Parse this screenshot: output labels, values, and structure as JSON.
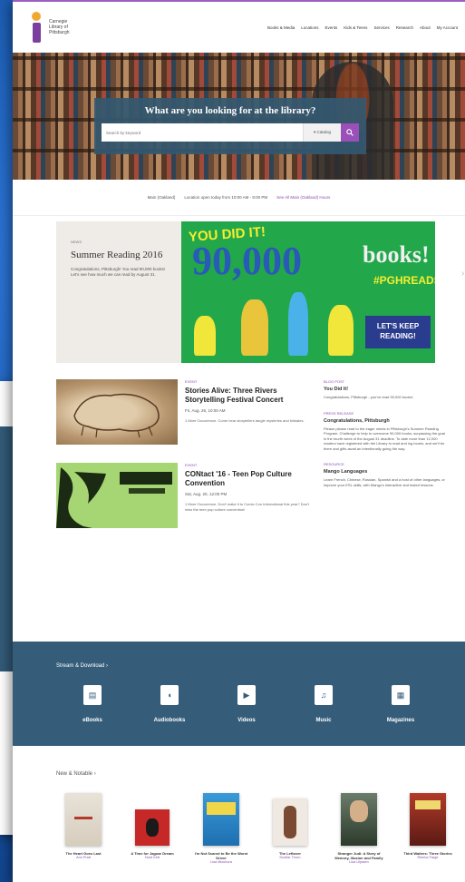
{
  "logo": {
    "line1": "Carnegie",
    "line2": "Library of",
    "line3": "Pittsburgh"
  },
  "nav": [
    "Books & Media",
    "Locations",
    "Events",
    "Kids & Teens",
    "Services",
    "Research",
    "About",
    "My Account"
  ],
  "search": {
    "title": "What are you looking for at the library?",
    "placeholder": "Search by keyword",
    "filter": "▾ Catalog",
    "submit_icon": "search-icon"
  },
  "hours": {
    "location": "Main (Oakland)",
    "hours_text": "Location open today from 10:00 AM - 8:00 PM",
    "link": "See All Main (Oakland) Hours"
  },
  "feature": {
    "kicker": "NEWS",
    "title": "Summer Reading 2016",
    "body": "Congratulations, Pittsburgh! You read 90,000 books! Let's see how much we can read by August 31.",
    "banner": {
      "you_did_it": "YOU DID IT!",
      "number": "90,000",
      "books": "books!",
      "hashtag": "#PGHREADS",
      "keep_reading_1": "LET'S KEEP",
      "keep_reading_2": "READING!"
    }
  },
  "events": [
    {
      "kicker": "EVENT",
      "title": "Stories Alive: Three Rivers Storytelling Festival Concert",
      "date": "Fri, Aug. 26, 10:00 AM",
      "desc": "1 More Occurrence. Come hear storytellers tangle mysteries and folktales."
    },
    {
      "kicker": "EVENT",
      "title": "CONtact '16 - Teen Pop Culture Convention",
      "date": "Sat, Aug. 20, 12:00 PM",
      "desc": "1 More Occurrence. Don't make it to Comic Con International this year? Don't miss the teen pop culture convention!"
    }
  ],
  "news": [
    {
      "kicker": "BLOG POST",
      "title": "You Did It!",
      "body": "Congratulations, Pittsburgh - you've read 90,000 books!"
    },
    {
      "kicker": "PRESS RELEASE",
      "title": "Congratulations, Pittsburgh",
      "body": "Please please read to the eager minds in Pittsburgh's Summer Reading Program. Challenge to help to overcome 90,000 books, surpassing the goal in the fourth week of the August 31 deadline. To date more than 12,000 readers have registered with the Library to read and log books, and we'll be there and gifts await an intentionally going the way."
    },
    {
      "kicker": "RESOURCE",
      "title": "Mango Languages",
      "body": "Learn French, Chinese, Russian, Spanish and a host of other languages, or improve your ESL skills, with Mango's interactive and tested lessons."
    }
  ],
  "stream": {
    "title": "Stream & Download",
    "items": [
      {
        "label": "eBooks",
        "icon": "ebook-icon"
      },
      {
        "label": "Audiobooks",
        "icon": "audiobook-icon"
      },
      {
        "label": "Videos",
        "icon": "video-icon"
      },
      {
        "label": "Music",
        "icon": "music-icon"
      },
      {
        "label": "Magazines",
        "icon": "magazine-icon"
      }
    ]
  },
  "notable": {
    "title": "New & Notable",
    "books": [
      {
        "title": "The Heart Goes Last",
        "author": "Ann Pratt"
      },
      {
        "title": "A Time for Jaguar Dream",
        "author": "Nord Kett"
      },
      {
        "title": "I'm Not Scared to Be the Worst Driver",
        "author": "Lisa Mizuhura"
      },
      {
        "title": "The Leftover",
        "author": "Duellar Thorn"
      },
      {
        "title": "Stranger Judi: A Story of Memory, Illusion and Family",
        "author": "Lisa Ulyssen"
      },
      {
        "title": "Third Walters: Three Stories",
        "author": "Reinha Farge"
      }
    ]
  }
}
